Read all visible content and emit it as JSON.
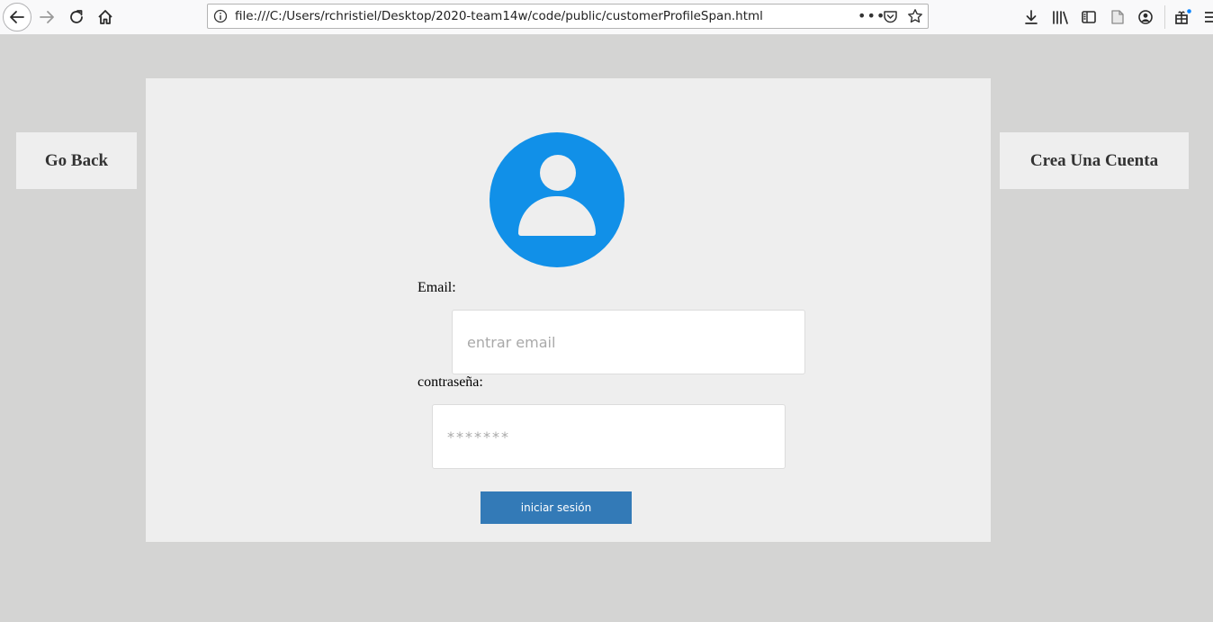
{
  "browser": {
    "url": "file:///C:/Users/rchristiel/Desktop/2020-team14w/code/public/customerProfileSpan.html",
    "more_label": "•••"
  },
  "nav": {
    "go_back_label": "Go Back",
    "create_account_label": "Crea Una Cuenta"
  },
  "login_form": {
    "email_label": "Email:",
    "email_placeholder": "entrar email",
    "email_value": "",
    "password_label": "contraseña:",
    "password_placeholder": "*******",
    "password_value": "",
    "submit_label": "iniciar sesión"
  },
  "colors": {
    "page_background": "#d4d4d3",
    "card_background": "#eeeeee",
    "avatar_blue": "#1190e8",
    "button_blue": "#337ab7"
  },
  "icons": [
    "back-arrow-icon",
    "forward-arrow-icon",
    "reload-icon",
    "home-icon",
    "info-icon",
    "pocket-icon",
    "bookmark-star-icon",
    "download-icon",
    "library-icon",
    "sidebar-icon",
    "reader-icon",
    "account-icon",
    "extensions-icon",
    "menu-icon",
    "user-avatar-icon"
  ]
}
